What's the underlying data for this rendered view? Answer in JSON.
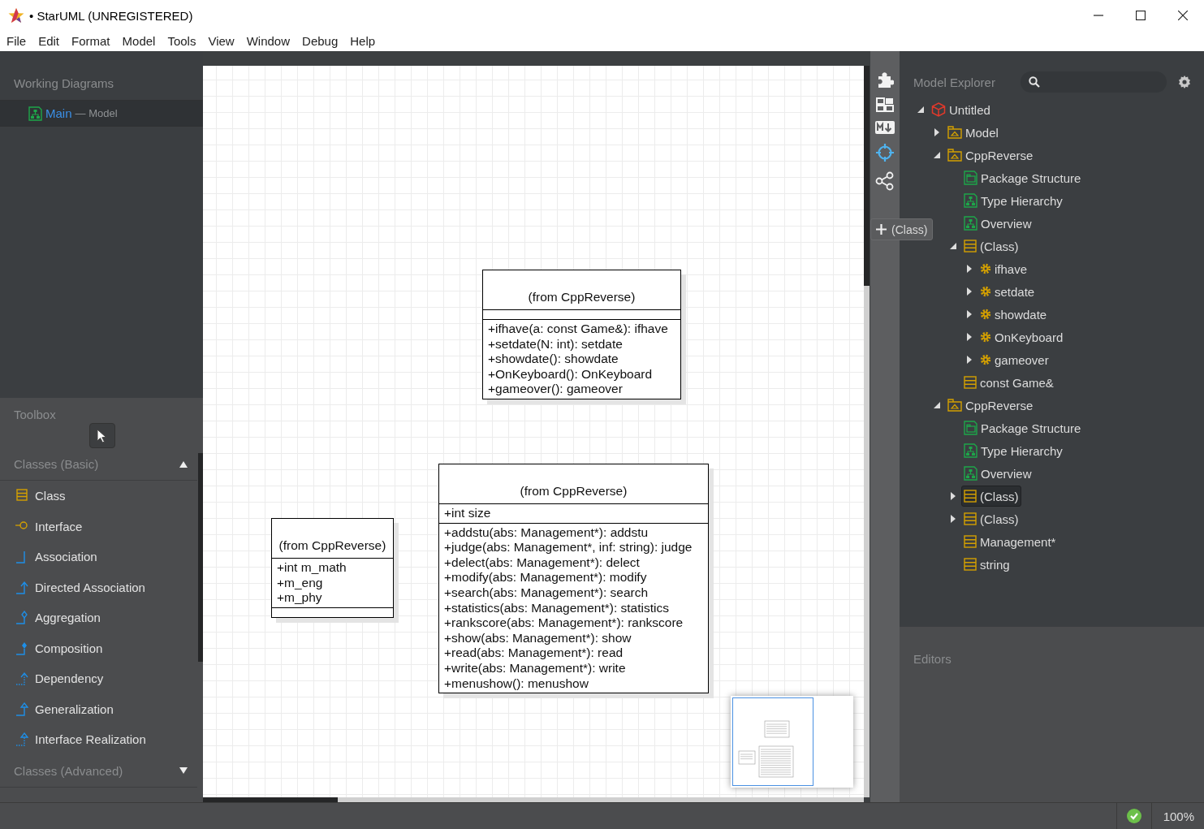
{
  "window": {
    "title": "• StarUML (UNREGISTERED)"
  },
  "menu": [
    "File",
    "Edit",
    "Format",
    "Model",
    "Tools",
    "View",
    "Window",
    "Debug",
    "Help"
  ],
  "working_diagrams": {
    "title": "Working Diagrams",
    "items": [
      {
        "name": "Main",
        "context": "— Model",
        "selected": true
      }
    ]
  },
  "toolbox": {
    "title": "Toolbox",
    "sections": [
      {
        "title": "Classes (Basic)",
        "expanded": true,
        "items": [
          {
            "label": "Class",
            "kind": "class"
          },
          {
            "label": "Interface",
            "kind": "interface"
          },
          {
            "label": "Association",
            "kind": "association"
          },
          {
            "label": "Directed Association",
            "kind": "directed"
          },
          {
            "label": "Aggregation",
            "kind": "aggregation"
          },
          {
            "label": "Composition",
            "kind": "composition"
          },
          {
            "label": "Dependency",
            "kind": "dependency"
          },
          {
            "label": "Generalization",
            "kind": "generalization"
          },
          {
            "label": "Interface Realization",
            "kind": "realization"
          }
        ]
      },
      {
        "title": "Classes (Advanced)",
        "expanded": false
      }
    ]
  },
  "diagram": {
    "classes": [
      {
        "name": "(from CppReverse)",
        "operations": [
          "+ifhave(a: const Game&): ifhave",
          "+setdate(N: int): setdate",
          "+showdate(): showdate",
          "+OnKeyboard(): OnKeyboard",
          "+gameover(): gameover"
        ]
      },
      {
        "name": "(from CppReverse)",
        "attributes": [
          "+int size"
        ],
        "operations": [
          "+addstu(abs: Management*): addstu",
          "+judge(abs: Management*, inf: string): judge",
          "+delect(abs: Management*): delect",
          "+modify(abs: Management*): modify",
          "+search(abs: Management*): search",
          "+statistics(abs: Management*): statistics",
          "+rankscore(abs: Management*): rankscore",
          "+show(abs: Management*): show",
          "+read(abs: Management*): read",
          "+write(abs: Management*): write",
          "+menushow(): menushow"
        ]
      },
      {
        "name": "(from CppReverse)",
        "attributes": [
          "+int m_math",
          "+m_eng",
          "+m_phy"
        ]
      }
    ]
  },
  "tooltip": {
    "label": "(Class)"
  },
  "model_explorer": {
    "title": "Model Explorer",
    "tree": [
      {
        "label": "Untitled",
        "kind": "project",
        "expanded": true,
        "selected": false,
        "children": [
          {
            "label": "Model",
            "kind": "package",
            "expanded": false,
            "selected": false
          },
          {
            "label": "CppReverse",
            "kind": "package",
            "expanded": true,
            "selected": false,
            "children": [
              {
                "label": "Package Structure",
                "kind": "package-diagram",
                "selected": false
              },
              {
                "label": "Type Hierarchy",
                "kind": "class-diagram",
                "selected": false
              },
              {
                "label": "Overview",
                "kind": "class-diagram",
                "selected": false
              },
              {
                "label": "(Class)",
                "kind": "class",
                "expanded": true,
                "selected": false,
                "children": [
                  {
                    "label": "ifhave",
                    "kind": "operation",
                    "expanded": false,
                    "selected": false
                  },
                  {
                    "label": "setdate",
                    "kind": "operation",
                    "expanded": false,
                    "selected": false
                  },
                  {
                    "label": "showdate",
                    "kind": "operation",
                    "expanded": false,
                    "selected": false
                  },
                  {
                    "label": "OnKeyboard",
                    "kind": "operation",
                    "expanded": false,
                    "selected": false
                  },
                  {
                    "label": "gameover",
                    "kind": "operation",
                    "expanded": false,
                    "selected": false
                  }
                ]
              },
              {
                "label": "const Game&",
                "kind": "class",
                "selected": false
              }
            ]
          },
          {
            "label": "CppReverse",
            "kind": "package",
            "expanded": true,
            "selected": false,
            "children": [
              {
                "label": "Package Structure",
                "kind": "package-diagram",
                "selected": false
              },
              {
                "label": "Type Hierarchy",
                "kind": "class-diagram",
                "selected": false
              },
              {
                "label": "Overview",
                "kind": "class-diagram",
                "selected": false
              },
              {
                "label": "(Class)",
                "kind": "class",
                "expanded": false,
                "selected": true
              },
              {
                "label": "(Class)",
                "kind": "class",
                "expanded": false,
                "selected": false
              },
              {
                "label": "Management*",
                "kind": "class",
                "selected": false
              },
              {
                "label": "string",
                "kind": "class",
                "selected": false
              }
            ]
          }
        ]
      }
    ]
  },
  "editors": {
    "title": "Editors"
  },
  "status_bar": {
    "zoom": "100%"
  }
}
